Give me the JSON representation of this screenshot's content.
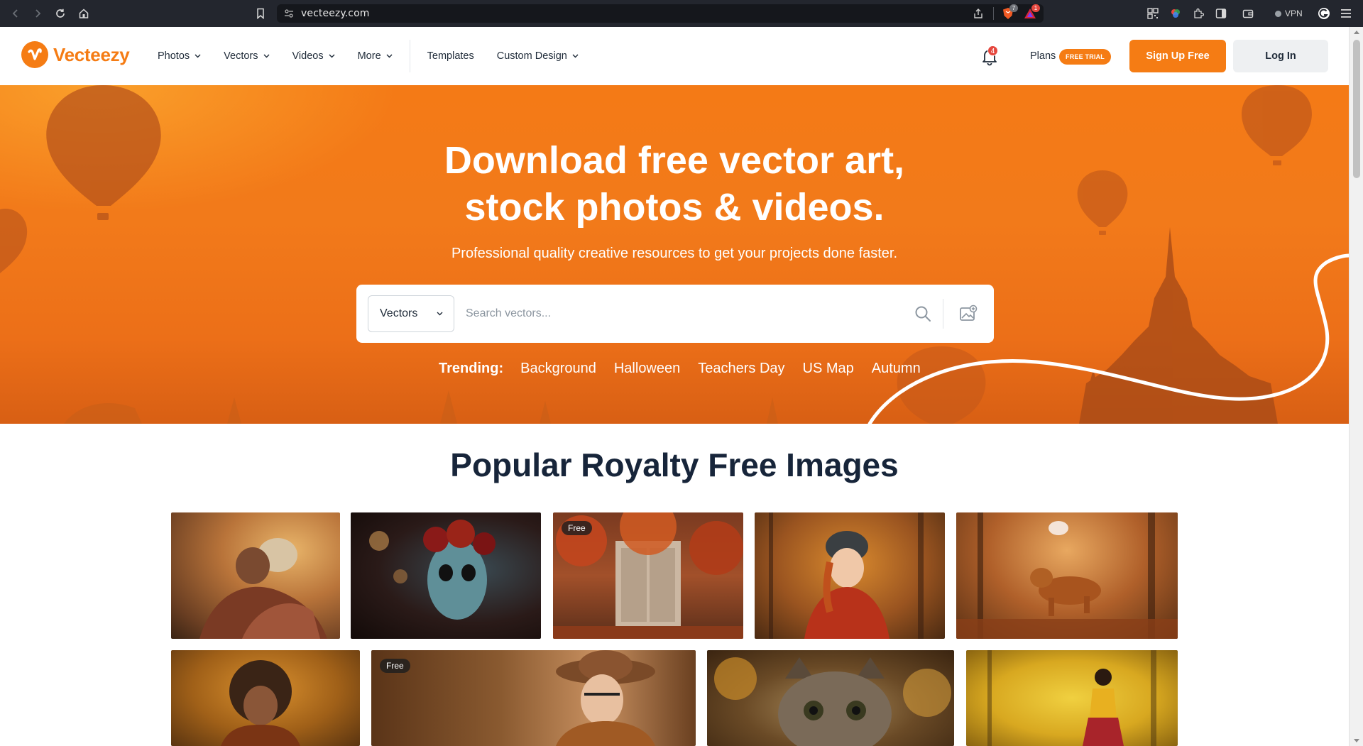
{
  "browser": {
    "url": "vecteezy.com",
    "extension_badges": {
      "brave_shields": "7",
      "brave_rewards": "1"
    },
    "vpn_label": "VPN"
  },
  "header": {
    "logo_text": "Vecteezy",
    "nav": [
      {
        "label": "Photos",
        "has_dropdown": true
      },
      {
        "label": "Vectors",
        "has_dropdown": true
      },
      {
        "label": "Videos",
        "has_dropdown": true
      },
      {
        "label": "More",
        "has_dropdown": true
      },
      {
        "label": "Templates",
        "has_dropdown": false
      },
      {
        "label": "Custom Design",
        "has_dropdown": true
      }
    ],
    "notification_count": "4",
    "plans_label": "Plans",
    "trial_badge": "FREE TRIAL",
    "signup_label": "Sign Up Free",
    "login_label": "Log In"
  },
  "hero": {
    "title_line1": "Download free vector art,",
    "title_line2": "stock photos & videos.",
    "subtitle": "Professional quality creative resources to get your projects done faster.",
    "search": {
      "category": "Vectors",
      "placeholder": "Search vectors..."
    },
    "trending_label": "Trending:",
    "trending": [
      "Background",
      "Halloween",
      "Teachers Day",
      "US Map",
      "Autumn"
    ]
  },
  "popular": {
    "title": "Popular Royalty Free Images",
    "free_label": "Free",
    "tiles": [
      {
        "subject": "elderly couple in autumn park",
        "free": false
      },
      {
        "subject": "woman with sugar skull makeup and flower crown",
        "free": false
      },
      {
        "subject": "old wooden door with autumn leaves",
        "free": true
      },
      {
        "subject": "smiling woman in beanie in autumn forest",
        "free": false
      },
      {
        "subject": "dog running through autumn leaves",
        "free": false
      },
      {
        "subject": "child with curly hair in autumn field",
        "free": false
      },
      {
        "subject": "woman in hat and glasses",
        "free": true
      },
      {
        "subject": "kitten in autumn leaves",
        "free": false
      },
      {
        "subject": "girl in yellow autumn forest",
        "free": false
      }
    ]
  },
  "colors": {
    "brand_orange": "#f57c14",
    "heading_dark": "#17253a",
    "badge_red": "#e5483f"
  }
}
